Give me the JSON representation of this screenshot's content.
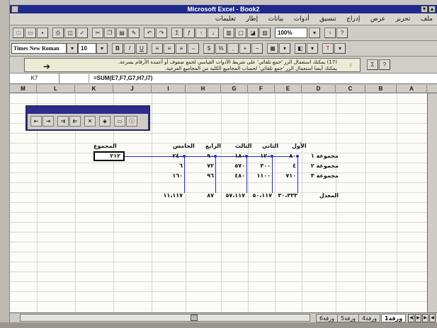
{
  "window": {
    "title": "Microsoft Excel - Book2"
  },
  "menu": [
    "ملف",
    "تحرير",
    "عرض",
    "إدراج",
    "تنسيق",
    "أدوات",
    "بيانات",
    "إطار",
    "تعليمات"
  ],
  "toolbar": {
    "zoom": "100%",
    "font_name": "Times New Roman",
    "font_size": "10"
  },
  "tip": {
    "line1": "(17) يمكنك استعمال الزر 'جمع تلقائي' على شريط الأدوات القياسي لجمع صفوف أو أعمدة الأرقام بسرعة.",
    "line2": "يمكنك أيضا استعمال الزر 'جمع تلقائي' لحساب المجاميع الكلية من المجاميع الفرعية."
  },
  "formula_bar": {
    "name_box": "K7",
    "formula": "=SUM(E7,F7,G7,H7,I7)"
  },
  "columns": [
    "M",
    "L",
    "K",
    "J",
    "I",
    "H",
    "G",
    "F",
    "E",
    "D",
    "C",
    "B",
    "A"
  ],
  "table": {
    "headers": [
      "المجموع",
      "الخامس",
      "الرابع",
      "الثالث",
      "الثاني",
      "الأول"
    ],
    "rows": [
      {
        "label": "مجموعة ١",
        "values": [
          "٢٤٠",
          "٩٠",
          "١٨٠",
          "١٢٠",
          "٨٠"
        ],
        "total": "٢١٢"
      },
      {
        "label": "مجموعة ٢",
        "values": [
          "٦",
          "٧٢",
          "٥٧٠",
          "٣٠٠",
          "٤"
        ]
      },
      {
        "label": "مجموعة ٣",
        "values": [
          "١٦٠",
          "٩٦",
          "٤٨٠",
          "١١٠٠",
          "٧١٠"
        ]
      }
    ],
    "avg_label": "المعدل",
    "averages": [
      "١١،١١٧",
      "٨٧",
      "٥٧،١١٧",
      "٥٠،١١٧",
      "٣٠،٣٣٣"
    ]
  },
  "sheet_tabs": [
    "ورقة1",
    "ورقة2",
    "ورقة3",
    "ورقة4",
    "ورقة5",
    "ورقة6"
  ]
}
